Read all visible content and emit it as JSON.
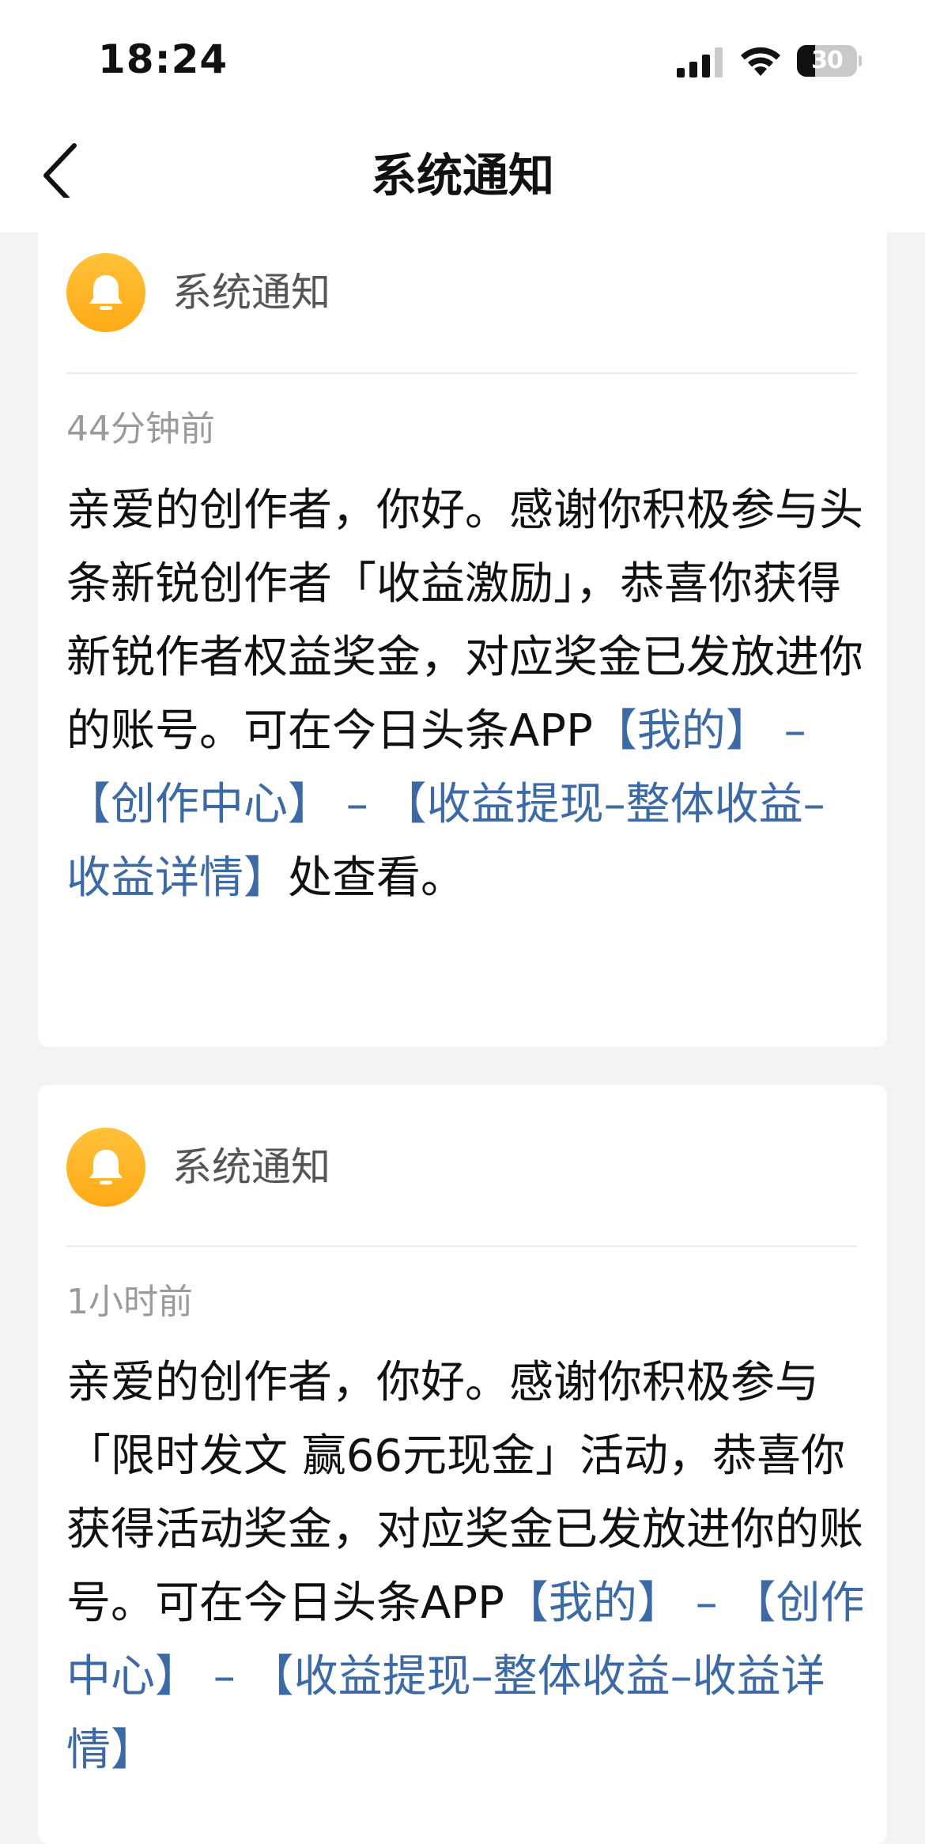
{
  "status_bar": {
    "time": "18:24",
    "battery_level": "30",
    "battery_fraction": 0.3,
    "signal_icon": "cellular-signal-icon",
    "wifi_icon": "wifi-icon"
  },
  "nav": {
    "back_icon": "chevron-left-icon",
    "title": "系统通知"
  },
  "colors": {
    "accent_link": "#3b6aa7",
    "avatar_orange": "#ffb01f",
    "background": "#f2f3f5"
  },
  "notifications": [
    {
      "sender": "系统通知",
      "avatar_icon": "bell-icon",
      "time": "44分钟前",
      "segments": [
        {
          "text": "亲爱的创作者，你好。感谢你积极参与头条新锐创作者「收益激励」，恭喜你获得新锐作者权益奖金，对应奖金已发放进你的账号。可在今日头条APP",
          "link": false
        },
        {
          "text": "【我的】 – 【创作中心】 – 【收益提现–整体收益–收益详情】",
          "link": true
        },
        {
          "text": "处查看。",
          "link": false
        }
      ]
    },
    {
      "sender": "系统通知",
      "avatar_icon": "bell-icon",
      "time": "1小时前",
      "segments": [
        {
          "text": "亲爱的创作者，你好。感谢你积极参与「限时发文 赢66元现金」活动，恭喜你获得活动奖金，对应奖金已发放进你的账号。可在今日头条APP",
          "link": false
        },
        {
          "text": "【我的】 – 【创作中心】 – 【收益提现–整体收益–收益详情】",
          "link": true
        }
      ]
    }
  ]
}
